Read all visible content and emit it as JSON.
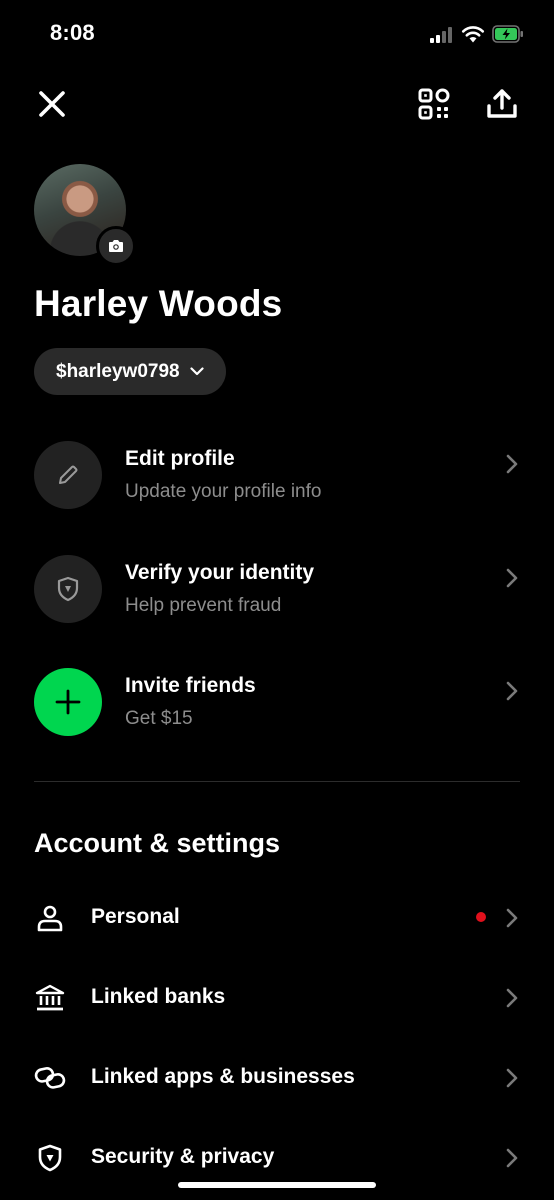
{
  "status_bar": {
    "time": "8:08"
  },
  "profile": {
    "name": "Harley Woods",
    "cashtag": "$harleyw0798"
  },
  "actions": [
    {
      "title": "Edit profile",
      "subtitle": "Update your profile info",
      "icon": "pencil-icon"
    },
    {
      "title": "Verify your identity",
      "subtitle": "Help prevent fraud",
      "icon": "shield-icon"
    },
    {
      "title": "Invite friends",
      "subtitle": "Get $15",
      "icon": "plus-icon"
    }
  ],
  "account_settings": {
    "title": "Account & settings",
    "items": [
      {
        "label": "Personal",
        "icon": "person-icon",
        "has_alert_dot": true
      },
      {
        "label": "Linked banks",
        "icon": "bank-icon"
      },
      {
        "label": "Linked apps & businesses",
        "icon": "link-icon"
      },
      {
        "label": "Security & privacy",
        "icon": "shield-icon"
      }
    ]
  },
  "colors": {
    "background": "#000000",
    "accent_green": "#00d64f",
    "alert_red": "#e0101c",
    "subtle_text": "#8d8d8d"
  }
}
